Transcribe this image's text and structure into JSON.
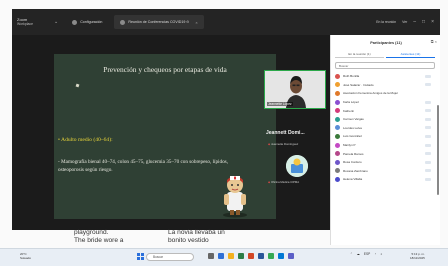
{
  "app": {
    "brand": "Zoom",
    "brand_sub": "Workplace"
  },
  "tabs": [
    {
      "label": "Configuración"
    },
    {
      "label": "Reunión de Conferencias COVID19 ⊙"
    }
  ],
  "window": {
    "status": "En la reunión",
    "view": "Ver",
    "view_label": "Vista"
  },
  "slide": {
    "title": "Prevención y chequeos por etapas de vida",
    "bullet": "• Adulto medio (40–64):",
    "body": "- Mamografía bienal 40–74, colon 45–75, glucemia 35–70 con sobrepeso, lípidos, osteoporosis según riesgo."
  },
  "video_tile": {
    "name": "Jeannette López",
    "large_name": "Jeannett Domi...",
    "mic_line": "Jeannette Domínguez",
    "sub_line2": "Oficina Médica CIPMA",
    "mic_icon": "mic-muted-icon"
  },
  "participants": {
    "title": "Participantes (11)",
    "tab_host": "En la reunión (1)",
    "tab_attendees": "Asistentes (11)",
    "search_placeholder": "Buscar",
    "list": [
      "Ruth Bonilla",
      "José Salazar · Invitado",
      "Asociación Femenina Amigos de la Mujer",
      "Karla López",
      "Katherin",
      "Carmen Vargas",
      "Lourdes Leiva",
      "Luis González",
      "Marilyn P",
      "Pamela Ramos",
      "Rosa Cordero",
      "Roxana Zambrano",
      "Helena Villalta"
    ]
  },
  "document": {
    "line1": "playground.",
    "line2": "The bride wore a",
    "line3": "La novia llevaba un",
    "line4": "bonito vestido"
  },
  "taskbar": {
    "weather_temp": "20°C",
    "weather_desc": "Soleado",
    "search": "Buscar",
    "lang": "ESP",
    "time": "5:13 p. m.",
    "date": "18/11/2025"
  },
  "colors": {
    "titlebar": "#242424",
    "slide_bg": "#2f4034",
    "slide_bullet": "#e8d53a",
    "active_video_border": "#2ba84a",
    "accent": "#1a73e8"
  }
}
